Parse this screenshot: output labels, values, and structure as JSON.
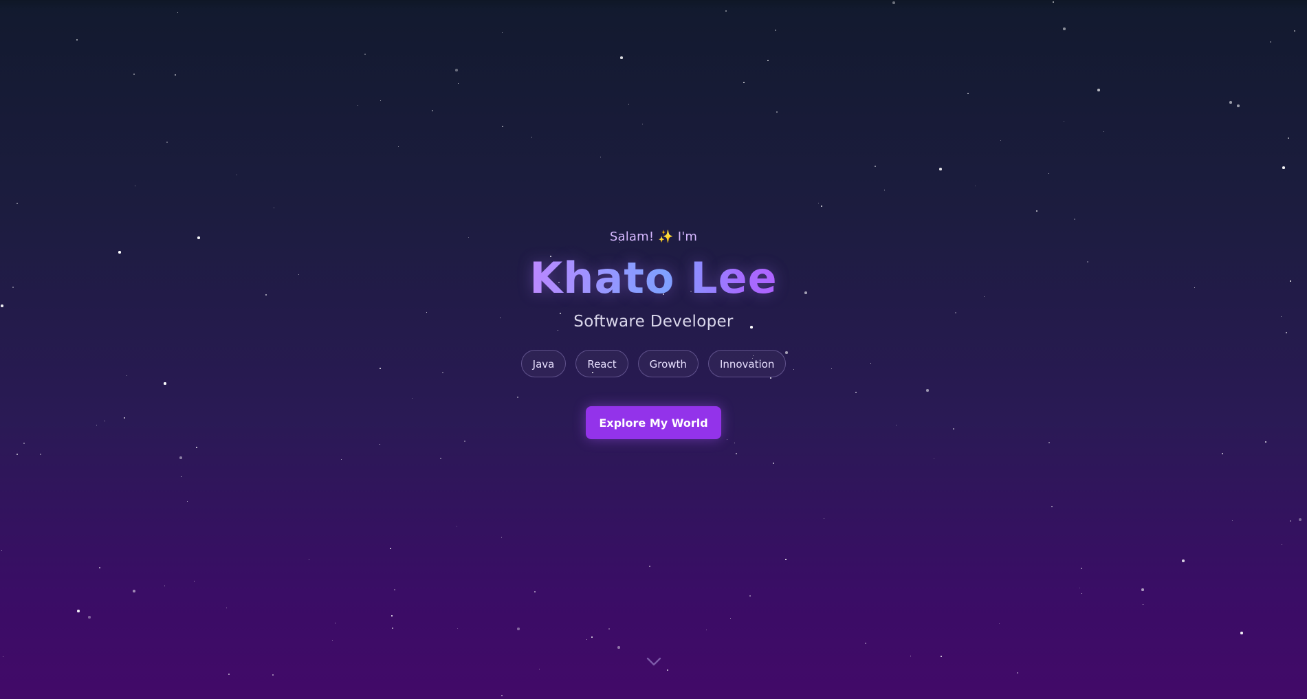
{
  "hero": {
    "greeting": "Salam! ✨ I'm",
    "name": "Khato Lee",
    "role": "Software Developer",
    "tags": [
      "Java",
      "React",
      "Growth",
      "Innovation"
    ],
    "cta_label": "Explore My World",
    "scroll_icon": "chevron-down-icon"
  },
  "colors": {
    "accent": "#9333ea",
    "greeting": "#d6b8ff",
    "name_gradient_start": "#c08cff",
    "name_gradient_mid": "#7aa8ff",
    "name_gradient_end": "#b060ff",
    "background_top": "#121a2e",
    "background_bottom": "#420a68"
  }
}
